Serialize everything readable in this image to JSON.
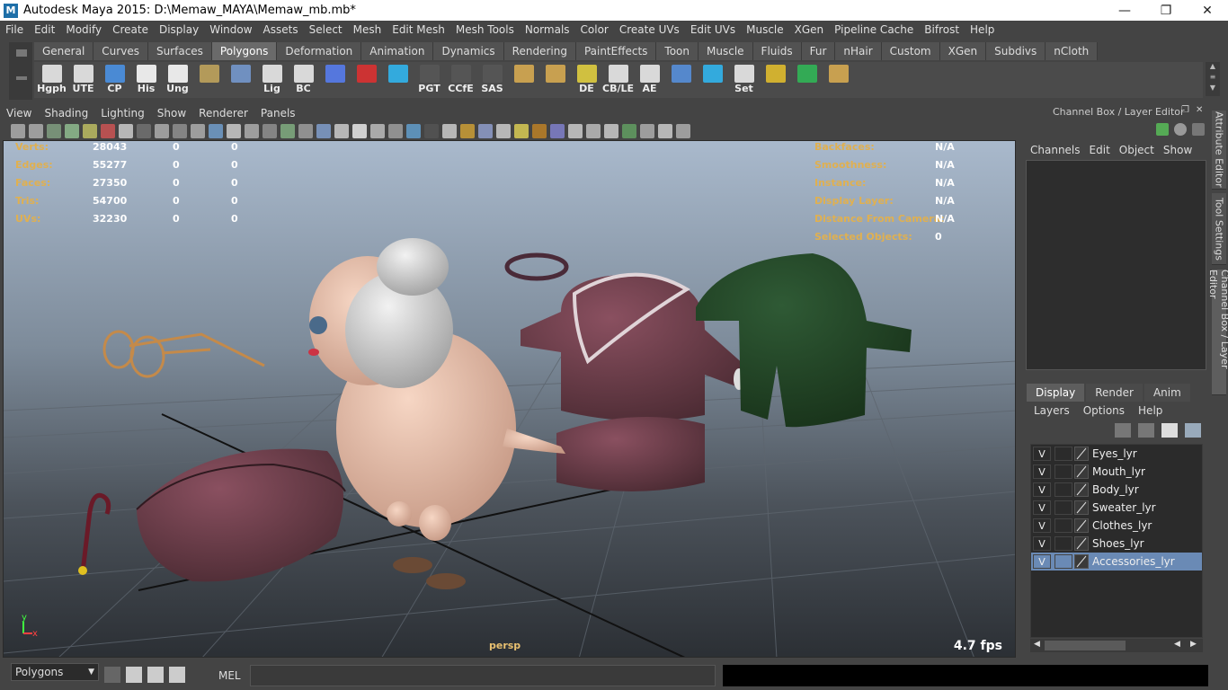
{
  "window": {
    "title": "Autodesk Maya 2015: D:\\Memaw_MAYA\\Memaw_mb.mb*",
    "minimize": "—",
    "maximize": "❐",
    "close": "✕"
  },
  "menubar": [
    "File",
    "Edit",
    "Modify",
    "Create",
    "Display",
    "Window",
    "Assets",
    "Select",
    "Mesh",
    "Edit Mesh",
    "Mesh Tools",
    "Normals",
    "Color",
    "Create UVs",
    "Edit UVs",
    "Muscle",
    "XGen",
    "Pipeline Cache",
    "Bifrost",
    "Help"
  ],
  "shelf": {
    "tabs": [
      "General",
      "Curves",
      "Surfaces",
      "Polygons",
      "Deformation",
      "Animation",
      "Dynamics",
      "Rendering",
      "PaintEffects",
      "Toon",
      "Muscle",
      "Fluids",
      "Fur",
      "nHair",
      "Custom",
      "XGen",
      "Subdivs",
      "nCloth"
    ],
    "active_tab": "Polygons",
    "icons": [
      {
        "label": "Hgph",
        "icon": "hypergraph-icon",
        "color": "#d9d9d9"
      },
      {
        "label": "UTE",
        "icon": "uv-editor-icon",
        "color": "#d9d9d9"
      },
      {
        "label": "CP",
        "icon": "cp-axis-icon",
        "color": "#4a8ad4"
      },
      {
        "label": "His",
        "icon": "history-icon",
        "color": "#e8e8e8"
      },
      {
        "label": "Ung",
        "icon": "ungroup-icon",
        "color": "#e8e8e8"
      },
      {
        "label": "",
        "icon": "book-icon",
        "color": "#b39a5a"
      },
      {
        "label": "",
        "icon": "globe-icon",
        "color": "#7090c0"
      },
      {
        "label": "Lig",
        "icon": "light-icon",
        "color": "#d9d9d9"
      },
      {
        "label": "BC",
        "icon": "eye-icon",
        "color": "#d9d9d9"
      },
      {
        "label": "",
        "icon": "lattice-icon",
        "color": "#5577dd"
      },
      {
        "label": "",
        "icon": "render-icon",
        "color": "#cc3333"
      },
      {
        "label": "",
        "icon": "curve-icon",
        "color": "#33aadd"
      },
      {
        "label": "PGT",
        "icon": "pgt-icon",
        "color": "#555555"
      },
      {
        "label": "CCfE",
        "icon": "ccfe-icon",
        "color": "#555555"
      },
      {
        "label": "SAS",
        "icon": "sas-icon",
        "color": "#555555"
      },
      {
        "label": "",
        "icon": "uv-layout-icon",
        "color": "#c8a050"
      },
      {
        "label": "",
        "icon": "uv-grid-icon",
        "color": "#c8a050"
      },
      {
        "label": "DE",
        "icon": "de-icon",
        "color": "#d0c040"
      },
      {
        "label": "CB/LE",
        "icon": "cb-le-icon",
        "color": "#d9d9d9"
      },
      {
        "label": "AE",
        "icon": "ae-icon",
        "color": "#d9d9d9"
      },
      {
        "label": "",
        "icon": "hose-icon",
        "color": "#5588cc"
      },
      {
        "label": "",
        "icon": "wave-icon",
        "color": "#33aadd"
      },
      {
        "label": "Set",
        "icon": "key-icon",
        "color": "#d9d9d9"
      },
      {
        "label": "",
        "icon": "target-icon",
        "color": "#d0b030"
      },
      {
        "label": "",
        "icon": "ring-target-icon",
        "color": "#33aa55"
      },
      {
        "label": "",
        "icon": "paint-icon",
        "color": "#c8a050"
      }
    ]
  },
  "viewport": {
    "menu": [
      "View",
      "Shading",
      "Lighting",
      "Show",
      "Renderer",
      "Panels"
    ],
    "hud_left": [
      {
        "label": "Verts:",
        "v1": "28043",
        "v2": "0",
        "v3": "0"
      },
      {
        "label": "Edges:",
        "v1": "55277",
        "v2": "0",
        "v3": "0"
      },
      {
        "label": "Faces:",
        "v1": "27350",
        "v2": "0",
        "v3": "0"
      },
      {
        "label": "Tris:",
        "v1": "54700",
        "v2": "0",
        "v3": "0"
      },
      {
        "label": "UVs:",
        "v1": "32230",
        "v2": "0",
        "v3": "0"
      }
    ],
    "hud_right": [
      {
        "label": "Backfaces:",
        "value": "N/A"
      },
      {
        "label": "Smoothness:",
        "value": "N/A"
      },
      {
        "label": "Instance:",
        "value": "N/A"
      },
      {
        "label": "Display Layer:",
        "value": "N/A"
      },
      {
        "label": "Distance From Camera:",
        "value": "N/A"
      },
      {
        "label": "Selected Objects:",
        "value": "0"
      }
    ],
    "camera": "persp",
    "fps": "4.7 fps",
    "axis_y": "y",
    "axis_x": "x"
  },
  "channelbox": {
    "title": "Channel Box / Layer Editor",
    "menu": [
      "Channels",
      "Edit",
      "Object",
      "Show"
    ]
  },
  "layers": {
    "tabs": [
      "Display",
      "Render",
      "Anim"
    ],
    "active_tab": "Display",
    "menu": [
      "Layers",
      "Options",
      "Help"
    ],
    "items": [
      {
        "vis": "V",
        "name": "Eyes_lyr",
        "selected": false
      },
      {
        "vis": "V",
        "name": "Mouth_lyr",
        "selected": false
      },
      {
        "vis": "V",
        "name": "Body_lyr",
        "selected": false
      },
      {
        "vis": "V",
        "name": "Sweater_lyr",
        "selected": false
      },
      {
        "vis": "V",
        "name": "Clothes_lyr",
        "selected": false
      },
      {
        "vis": "V",
        "name": "Shoes_lyr",
        "selected": false
      },
      {
        "vis": "V",
        "name": "Accessories_lyr",
        "selected": true
      }
    ]
  },
  "side_tabs": [
    "Attribute Editor",
    "Tool Settings",
    "Channel Box / Layer Editor"
  ],
  "statusbar": {
    "mode": "Polygons",
    "script_lang": "MEL"
  },
  "colors": {
    "ui_bg": "#444444",
    "hud_label": "#e0b050",
    "selected_layer": "#6a8ab5",
    "viewport_top": "#a9b9cc",
    "viewport_bottom": "#2b2f34"
  }
}
